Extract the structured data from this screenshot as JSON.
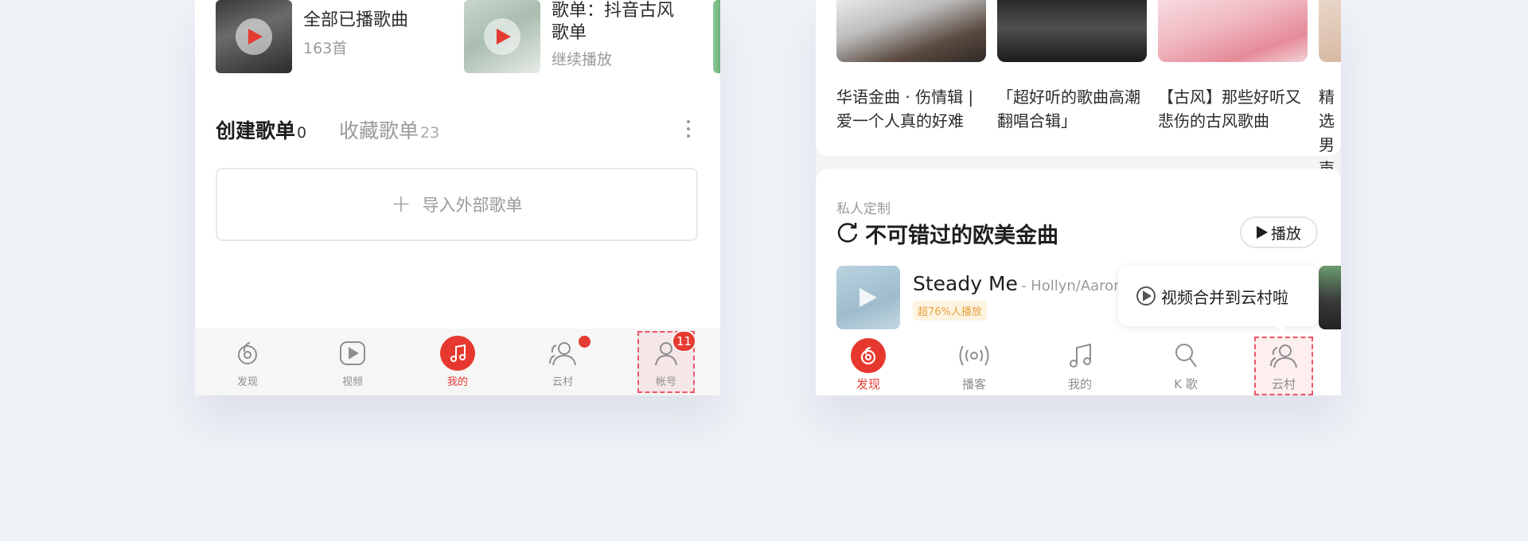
{
  "left_phone": {
    "playlists": [
      {
        "title": "全部已播歌曲",
        "subtitle": "163首"
      },
      {
        "title": "歌单：抖音古风歌单",
        "subtitle": "继续播放"
      }
    ],
    "tabs": [
      {
        "label": "创建歌单",
        "count": "0"
      },
      {
        "label": "收藏歌单",
        "count": "23"
      }
    ],
    "import_label": "导入外部歌单",
    "nav": [
      {
        "label": "发现",
        "icon": "discover-icon"
      },
      {
        "label": "视频",
        "icon": "video-icon"
      },
      {
        "label": "我的",
        "icon": "music-note-icon"
      },
      {
        "label": "云村",
        "icon": "friends-icon"
      },
      {
        "label": "帐号",
        "icon": "account-icon"
      }
    ],
    "account_badge": "11",
    "colors": {
      "accent": "#e33b32",
      "highlight": "#ef5466"
    }
  },
  "right_phone": {
    "recommendations": [
      {
        "caption": "华语金曲 · 伤情辑 | 爱一个人真的好难"
      },
      {
        "caption": "「超好听的歌曲高潮翻唱合辑」"
      },
      {
        "caption": "【古风】那些好听又悲伤的古风歌曲"
      },
      {
        "caption": "精选男声"
      }
    ],
    "section": {
      "label": "私人定制",
      "title": "不可错过的欧美金曲",
      "play_label": "播放"
    },
    "song": {
      "title": "Steady Me",
      "artist": "- Hollyn/Aaron",
      "tag": "超76%人播放"
    },
    "tooltip": "视频合并到云村啦",
    "nav": [
      {
        "label": "发现",
        "icon": "discover-icon"
      },
      {
        "label": "播客",
        "icon": "podcast-icon"
      },
      {
        "label": "我的",
        "icon": "music-note-icon"
      },
      {
        "label": "K 歌",
        "icon": "mic-icon"
      },
      {
        "label": "云村",
        "icon": "friends-icon"
      }
    ]
  }
}
